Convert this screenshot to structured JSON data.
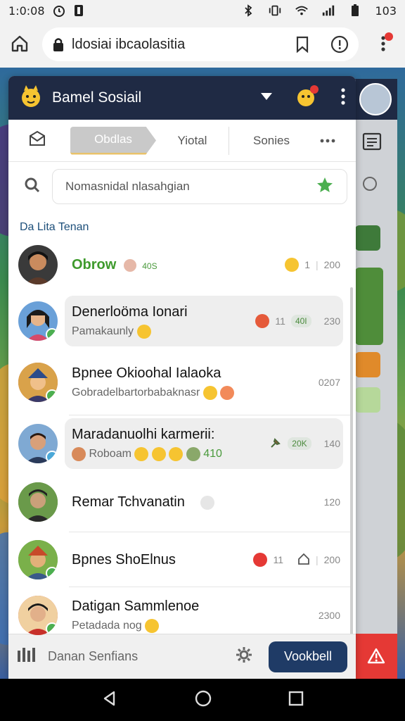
{
  "status_bar": {
    "time": "1:0:08",
    "battery": "103",
    "icons": [
      "alarm-icon",
      "sim-icon",
      "bluetooth-icon",
      "vibrate-icon",
      "wifi-icon",
      "signal-icon",
      "battery-icon"
    ]
  },
  "browser": {
    "url": "ldosiai ibcaolasitia",
    "icons": [
      "home-icon",
      "lock-icon",
      "bookmark-icon",
      "info-icon",
      "menu-icon"
    ]
  },
  "popup": {
    "title": "Bamel Sosiail",
    "tabs": [
      {
        "label": "Obdlas",
        "active": true
      },
      {
        "label": "Yiotal",
        "active": false
      },
      {
        "label": "Sonies",
        "active": false
      }
    ],
    "search_placeholder": "Nomasnidal nlasahgian",
    "section_title": "Da Lita Tenan",
    "contacts": [
      {
        "name": "Obrow",
        "name_style": "green",
        "sub": "",
        "inline_tag": "40S",
        "meta_count": "1",
        "meta_time": "200",
        "highlight": false,
        "avatar_color": "#3a3a3a"
      },
      {
        "name": "Denerloöma Ionari",
        "sub": "Pamakaunly",
        "meta_count": "11",
        "meta_pill": "40I",
        "meta_time": "230",
        "highlight": true,
        "avatar_color": "#6aa0d8"
      },
      {
        "name": "Bpnee Okioohal Ialaoka",
        "sub": "Gobradelbartorbabaknasr",
        "meta_time": "0207",
        "highlight": false,
        "avatar_color": "#c75b2b"
      },
      {
        "name": "Maradanuolhi karmerii:",
        "sub": "Roboam",
        "meta_pill": "20K",
        "inline_tag": "410",
        "meta_time": "140",
        "highlight": true,
        "avatar_color": "#7fa9d3"
      },
      {
        "name": "Remar Tchvanatin",
        "sub": "",
        "meta_time": "120",
        "highlight": false,
        "avatar_color": "#5c7a3a"
      },
      {
        "name": "Bpnes ShoElnus",
        "sub": "",
        "meta_count": "11",
        "meta_time": "200",
        "highlight": false,
        "avatar_color": "#5aa04a"
      },
      {
        "name": "Datigan Sammlenoe",
        "sub": "Petadada nog",
        "meta_time": "2300",
        "highlight": false,
        "avatar_color": "#d24b3a"
      }
    ],
    "footer_text": "Danan Senfians",
    "footer_button": "Vookbell"
  },
  "colors": {
    "header_bg": "#1f2a44",
    "accent_green": "#3e9a2c",
    "button_blue": "#1f3b66",
    "alert_red": "#e53935"
  }
}
